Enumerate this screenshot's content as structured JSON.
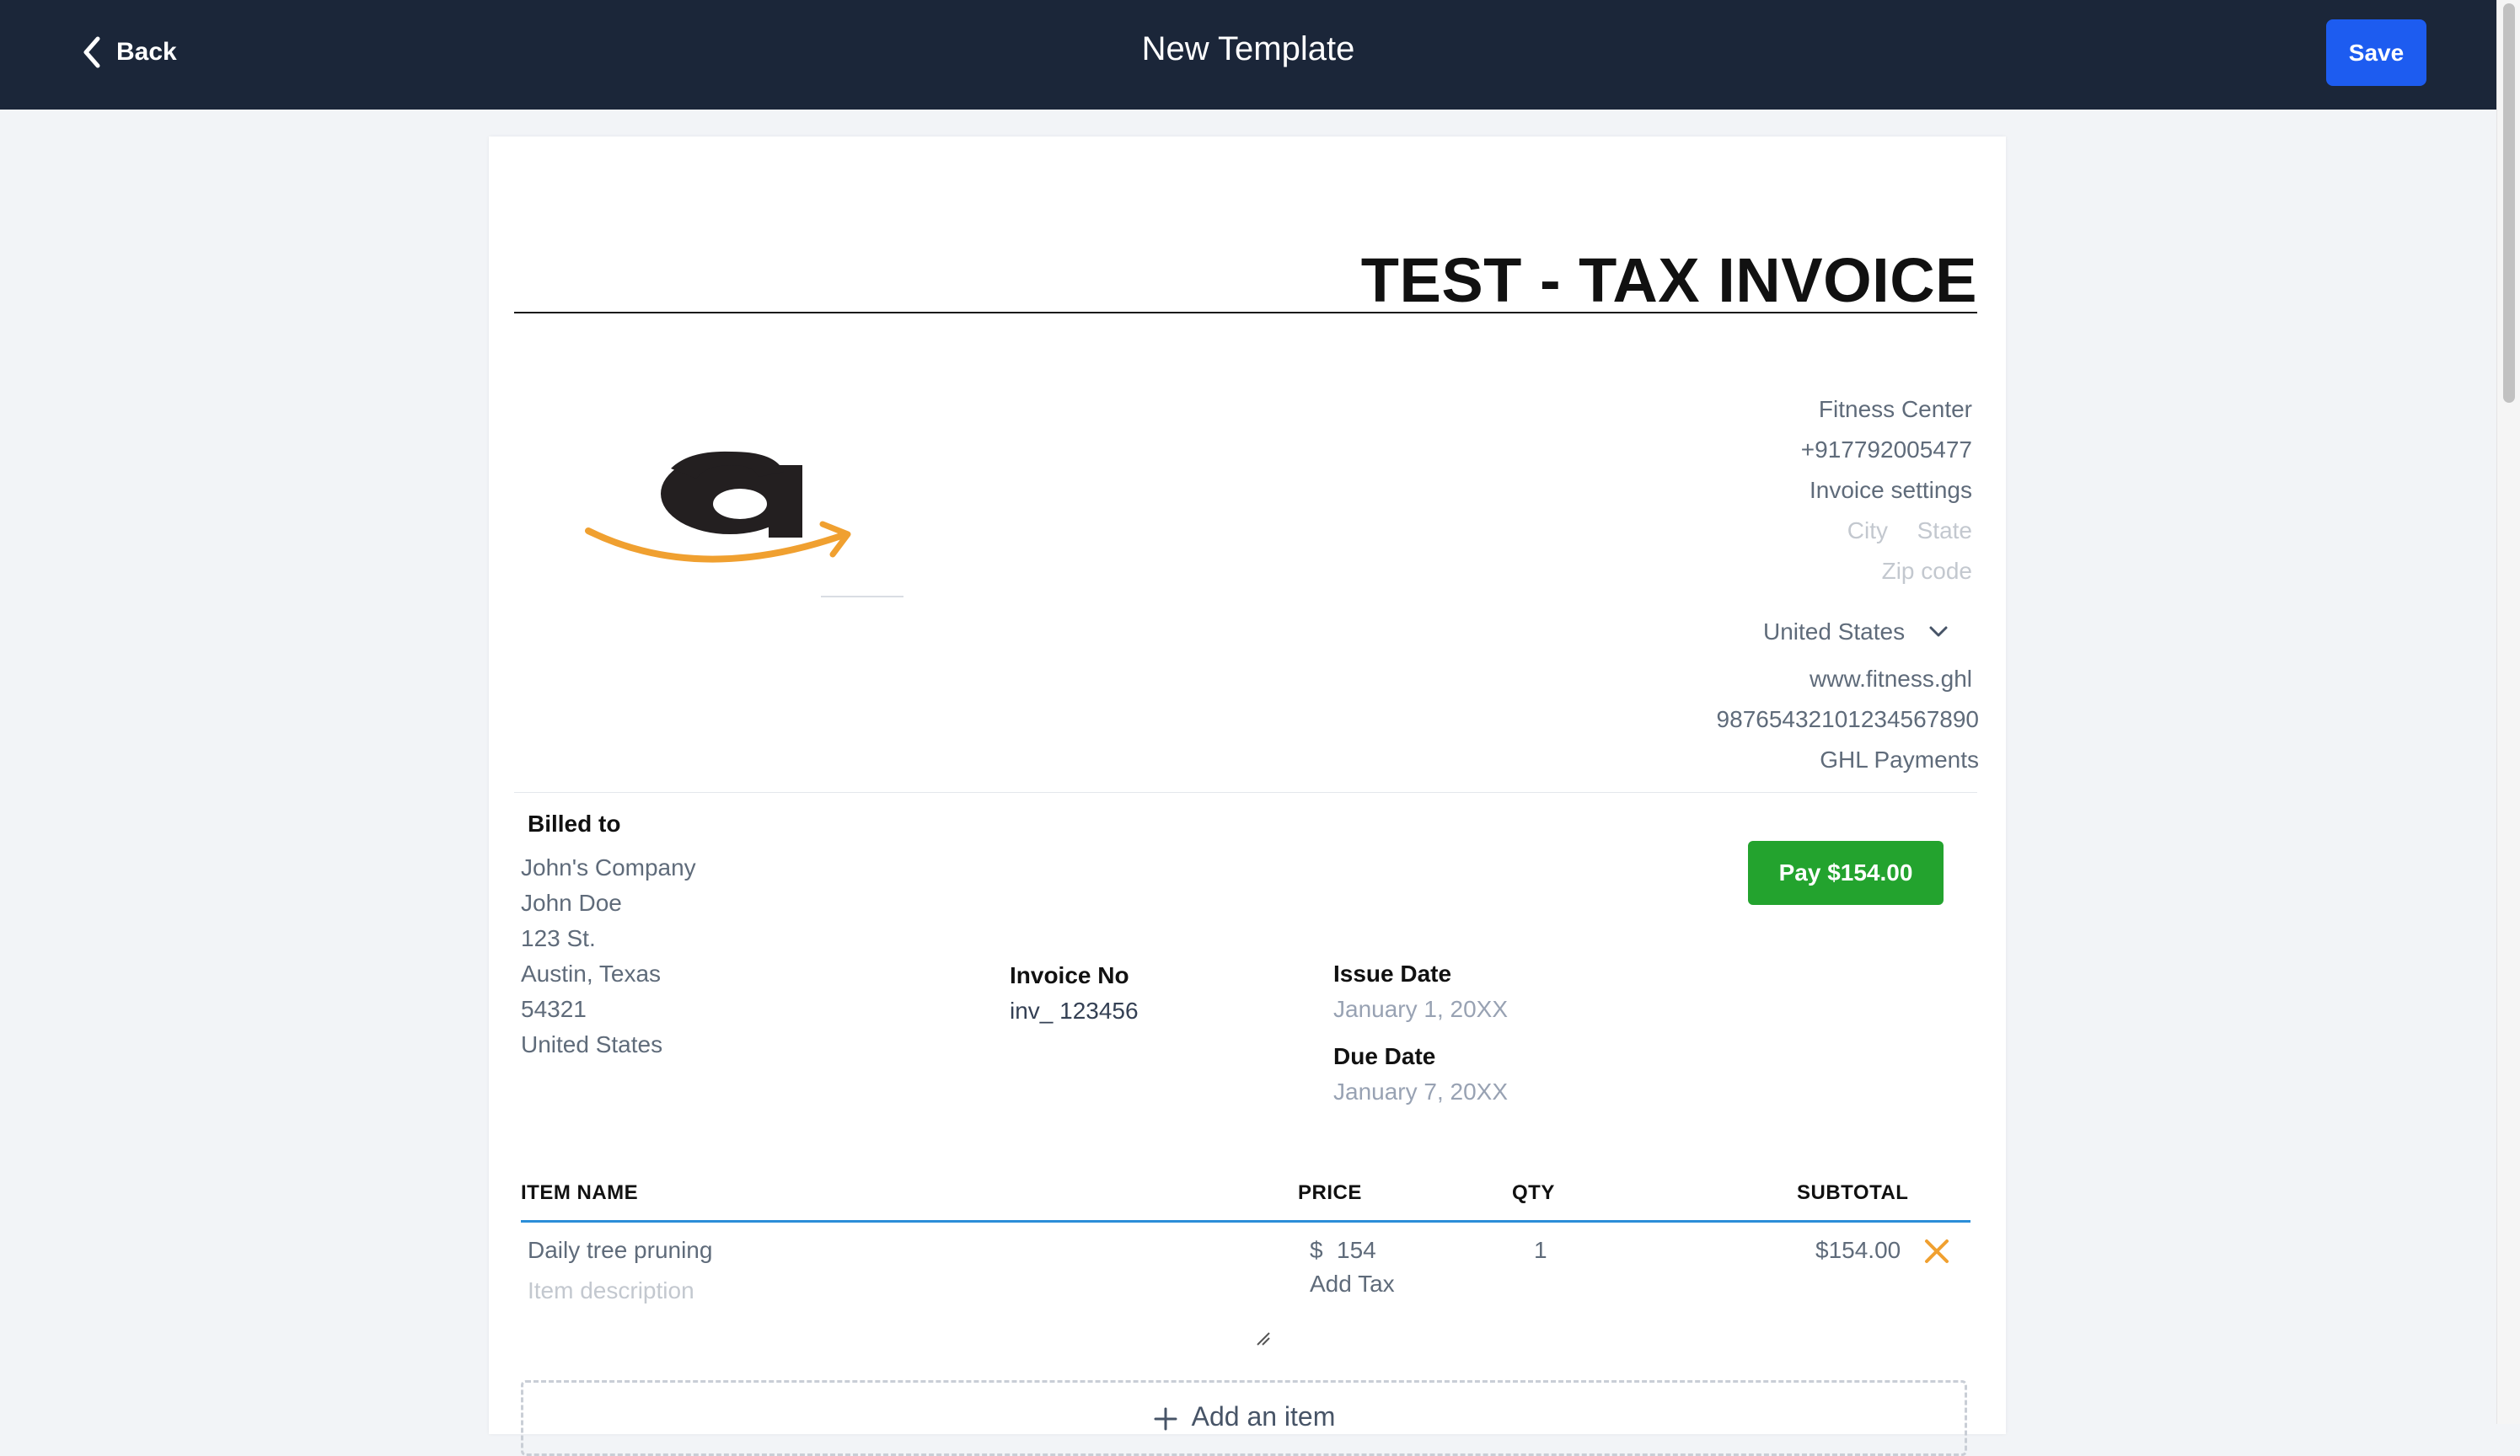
{
  "header": {
    "back_label": "Back",
    "title": "New Template",
    "save_label": "Save"
  },
  "invoice": {
    "heading": "TEST - TAX INVOICE"
  },
  "business": {
    "name": "Fitness Center",
    "phone": "+917792005477",
    "address_line": "Invoice settings",
    "city_placeholder": "City",
    "state_placeholder": "State",
    "zip_placeholder": "Zip code",
    "country": "United States",
    "website": "www.fitness.ghl",
    "tax_id": "98765432101234567890",
    "payment_name": "GHL Payments"
  },
  "billed_to": {
    "label": "Billed to",
    "company": "John's Company",
    "name": "John Doe",
    "street": "123 St.",
    "city_state": "Austin, Texas",
    "zip": "54321",
    "country": "United States"
  },
  "invoice_meta": {
    "number_label": "Invoice No",
    "number_value": "inv_ 123456",
    "issue_label": "Issue Date",
    "issue_value": "January 1, 20XX",
    "due_label": "Due Date",
    "due_value": "January 7, 20XX"
  },
  "pay_button": "Pay $154.00",
  "table": {
    "headers": {
      "item": "ITEM NAME",
      "price": "PRICE",
      "qty": "QTY",
      "subtotal": "SUBTOTAL"
    },
    "rows": [
      {
        "name": "Daily tree pruning",
        "description_placeholder": "Item description",
        "currency": "$",
        "price": "154",
        "add_tax": "Add Tax",
        "qty": "1",
        "subtotal": "$154.00"
      }
    ],
    "add_item_label": "Add an item"
  },
  "colors": {
    "topbar": "#1b2639",
    "save_button": "#1d5cf0",
    "pay_button": "#23a32e",
    "table_header_line": "#2b8ed8",
    "remove_icon": "#f0a030"
  },
  "icons": {
    "back": "chevron-left-icon",
    "country_dropdown": "chevron-down-icon",
    "remove_row": "close-icon",
    "add_item": "plus-icon",
    "logo": "amazon-logo"
  }
}
